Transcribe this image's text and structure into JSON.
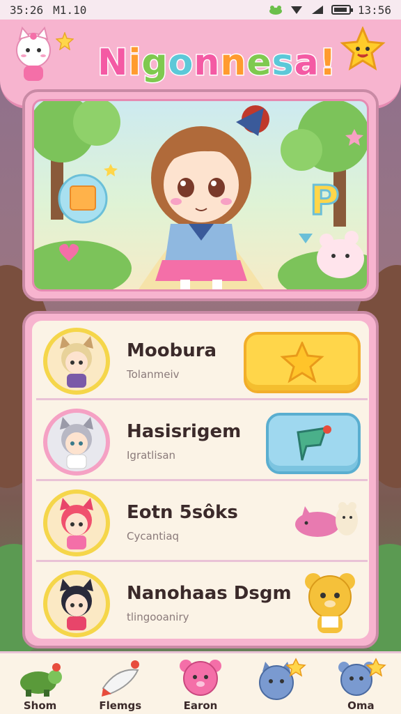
{
  "status_bar": {
    "time": "35:26",
    "carrier": "M1.10",
    "clock": "13:56"
  },
  "header": {
    "title": "Nigonnesa!"
  },
  "hero": {
    "badge_letter": "P"
  },
  "characters": [
    {
      "name": "Moobura",
      "subtitle": "Tolanmeiv",
      "action_icon": "star-icon",
      "color": "#ffd64a"
    },
    {
      "name": "Hasisrigem",
      "subtitle": "Igratlisan",
      "action_icon": "flag-icon",
      "color": "#9fd8ef"
    },
    {
      "name": "Eotn 5sôks",
      "subtitle": "Cycantiaq",
      "action_icon": "pig-pet-icon",
      "color": ""
    },
    {
      "name": "Nanohaas Dsgm",
      "subtitle": "tlingooaniry",
      "action_icon": "bear-pet-icon",
      "color": ""
    }
  ],
  "nav": [
    {
      "label": "Shom",
      "icon": "turtle-icon"
    },
    {
      "label": "Flemgs",
      "icon": "rocket-icon"
    },
    {
      "label": "Earon",
      "icon": "pink-bear-icon"
    },
    {
      "label": "",
      "icon": "blue-cat-star-icon"
    },
    {
      "label": "Oma",
      "icon": "blue-bear-star-icon"
    }
  ]
}
